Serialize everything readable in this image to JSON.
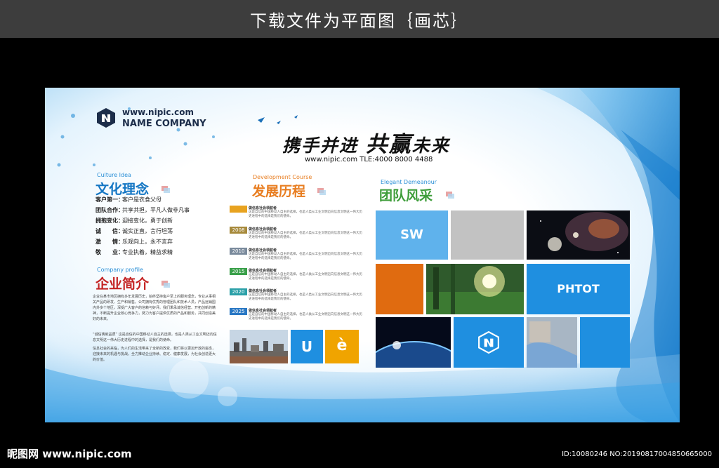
{
  "banner": {
    "title": "下载文件为平面图｛画芯｝"
  },
  "board": {
    "url": "www.nipic.com",
    "company": "NAME COMPANY",
    "culture": {
      "en": "Culture Idea",
      "title": "文化理念",
      "items": [
        {
          "key": "客户第一：",
          "value": "客户是衣食父母"
        },
        {
          "key": "团队合作：",
          "value": "共享共担，平凡人做非凡事"
        },
        {
          "key": "拥抱变化：",
          "value": "迎接变化，勇于创新"
        },
        {
          "key": "诚　　信：",
          "value": "诚实正直，言行坦荡"
        },
        {
          "key": "激　　情：",
          "value": "乐观向上，永不言弃"
        },
        {
          "key": "敬　　业：",
          "value": "专业执着，精益求精"
        }
      ]
    },
    "profile": {
      "en": "Company profile",
      "title": "企业简介",
      "paragraphs": [
        "企业在某市地区拥有多年发展历史，始终坚持客户至上的服务理念，专业从事相关产品的研发、生产和销售。公司拥有优秀的管理团队和技术人员，产品远销国内外多个地区，深受广大客户的信赖与好评。我们秉承诚信经营、开拓创新的精神，不断提升企业核心竞争力，努力为客户提供优质的产品和服务，共同创造美好的未来。",
        "“诚信铸就品质” 这是自信的中国移动人自主的选择，也是人类从工业文明迈向信息文明这一伟大历史进程中的选择，是我们的使命。",
        "信息社会的来临，为人们的生活带来了全新的改变，我们将以更加开放的姿态，迎接未来的机遇与挑战，全力推动企业持续、稳定、健康发展，为社会创造更大的价值。"
      ]
    },
    "slogan": {
      "part1": "携手并进",
      "part2": "共赢",
      "part3": "未来"
    },
    "contact": "www.nipic.com    TLE:4000 8000 4488",
    "development": {
      "en": "Development Course",
      "title": "发展历程",
      "items": [
        {
          "year": "",
          "color": "#e8a320",
          "title": "做信息社会领航者",
          "text": "这是自信的中国移动人自主的选择，也是人类从工业文明迈向信息文明这一伟大历史进程中的选择是我们的使命。"
        },
        {
          "year": "2008",
          "color": "#a78a3c",
          "title": "做信息社会领航者",
          "text": "这是自信的中国移动人自主的选择，也是人类从工业文明迈向信息文明这一伟大历史进程中的选择是我们的使命。"
        },
        {
          "year": "2010",
          "color": "#7a8a9c",
          "title": "做信息社会领航者",
          "text": "这是自信的中国移动人自主的选择，也是人类从工业文明迈向信息文明这一伟大历史进程中的选择是我们的使命。"
        },
        {
          "year": "2015",
          "color": "#3aa04a",
          "title": "做信息社会领航者",
          "text": "这是自信的中国移动人自主的选择，也是人类从工业文明迈向信息文明这一伟大历史进程中的选择是我们的使命。"
        },
        {
          "year": "2020",
          "color": "#2ba0a8",
          "title": "做信息社会领航者",
          "text": "这是自信的中国移动人自主的选择，也是人类从工业文明迈向信息文明这一伟大历史进程中的选择是我们的使命。"
        },
        {
          "year": "2025",
          "color": "#2a78c4",
          "title": "做信息社会领航者",
          "text": "这是自信的中国移动人自主的选择，也是人类从工业文明迈向信息文明这一伟大历史进程中的选择是我们的使命。"
        }
      ],
      "tile_u": "U",
      "tile_e": "è"
    },
    "team": {
      "en": "Elegant Demeanour",
      "title": "团队风采",
      "tile_sw": "SW",
      "tile_photo": "PHTOT"
    }
  },
  "footer": {
    "site": "昵图网 www.nipic.com",
    "id": "ID:10080246 NO:20190817004850665000"
  }
}
